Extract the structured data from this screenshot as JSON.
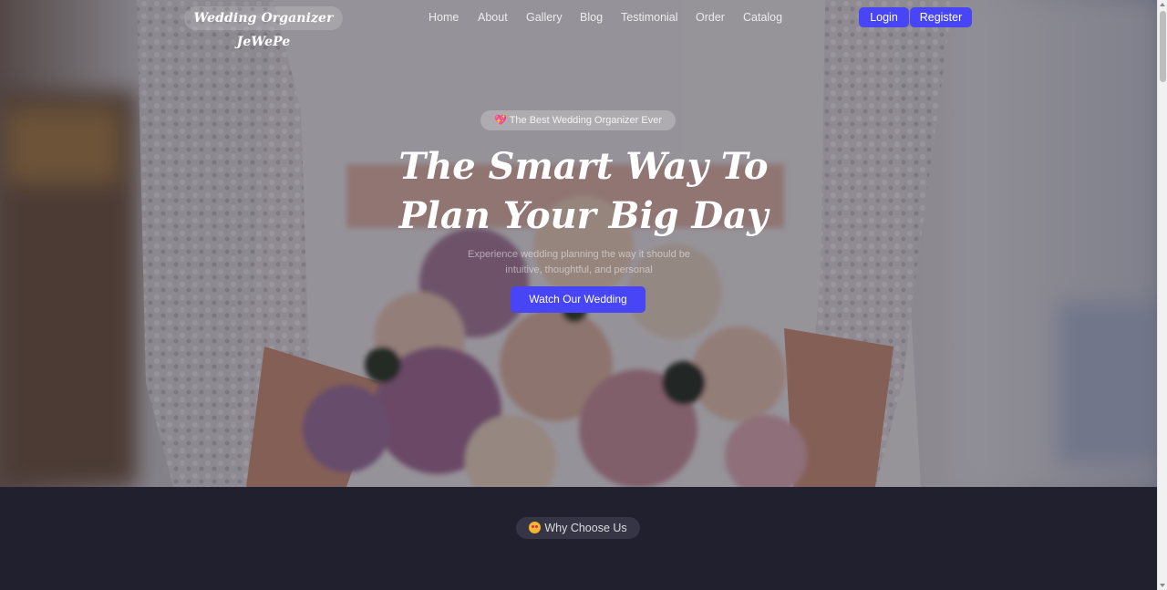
{
  "nav": {
    "brand": "Wedding Organizer JeWePe",
    "links": [
      "Home",
      "About",
      "Gallery",
      "Blog",
      "Testimonial",
      "Order",
      "Catalog"
    ],
    "login": "Login",
    "register": "Register"
  },
  "hero": {
    "badge_icon": "💖",
    "badge": "The Best Wedding Organizer Ever",
    "title_line1": "The Smart Way To",
    "title_line2": "Plan Your Big Day",
    "subtitle_line1": "Experience wedding planning the way it should be",
    "subtitle_line2": "intuitive, thoughtful, and personal",
    "cta": "Watch Our Wedding"
  },
  "section": {
    "badge": "Why Choose Us"
  },
  "colors": {
    "accent": "#4745f5",
    "section_bg": "#21202e"
  },
  "icons": {
    "badge": "sparkling-heart-icon",
    "section": "star-struck-emoji-icon"
  }
}
